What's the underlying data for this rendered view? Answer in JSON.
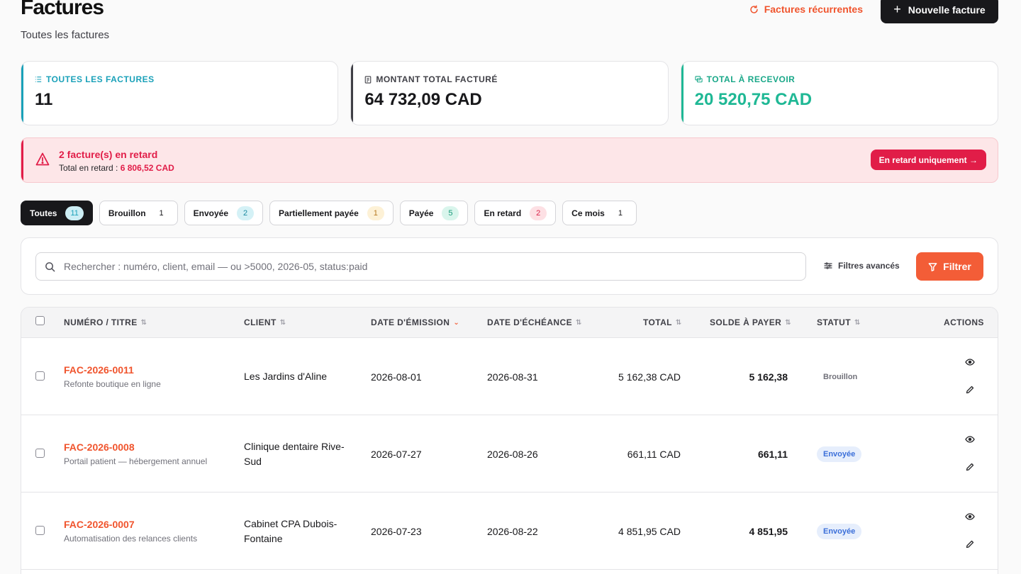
{
  "header": {
    "title": "Factures",
    "subtitle": "Toutes les factures",
    "recurring_label": "Factures récurrentes",
    "new_invoice_label": "Nouvelle facture"
  },
  "stats": [
    {
      "label": "TOUTES LES FACTURES",
      "value": "11",
      "icon": "list-icon"
    },
    {
      "label": "MONTANT TOTAL FACTURÉ",
      "value": "64 732,09 CAD",
      "icon": "receipt-icon"
    },
    {
      "label": "TOTAL À RECEVOIR",
      "value": "20 520,75 CAD",
      "icon": "coins-icon"
    }
  ],
  "alert": {
    "title": "2 facture(s) en retard",
    "sub_prefix": "Total en retard :",
    "sub_amount": "6 806,52 CAD",
    "button": "En retard uniquement →"
  },
  "filters": [
    {
      "label": "Toutes",
      "count": "11"
    },
    {
      "label": "Brouillon",
      "count": "1"
    },
    {
      "label": "Envoyée",
      "count": "2"
    },
    {
      "label": "Partiellement payée",
      "count": "1"
    },
    {
      "label": "Payée",
      "count": "5"
    },
    {
      "label": "En retard",
      "count": "2"
    },
    {
      "label": "Ce mois",
      "count": "1"
    }
  ],
  "search": {
    "placeholder": "Rechercher : numéro, client, email — ou >5000, 2026-05, status:paid",
    "advanced_label": "Filtres avancés",
    "filter_button": "Filtrer"
  },
  "table": {
    "columns": {
      "number": "NUMÉRO / TITRE",
      "client": "CLIENT",
      "issue": "DATE D'ÉMISSION",
      "due": "DATE D'ÉCHÉANCE",
      "total": "TOTAL",
      "balance": "SOLDE À PAYER",
      "status": "STATUT",
      "actions": "ACTIONS"
    },
    "rows": [
      {
        "number": "FAC-2026-0011",
        "title": "Refonte boutique en ligne",
        "client": "Les Jardins d'Aline",
        "issue": "2026-08-01",
        "due": "2026-08-31",
        "total": "5 162,38 CAD",
        "balance": "5 162,38",
        "status": "Brouillon"
      },
      {
        "number": "FAC-2026-0008",
        "title": "Portail patient — hébergement annuel",
        "client": "Clinique dentaire Rive-Sud",
        "issue": "2026-07-27",
        "due": "2026-08-26",
        "total": "661,11 CAD",
        "balance": "661,11",
        "status": "Envoyée"
      },
      {
        "number": "FAC-2026-0007",
        "title": "Automatisation des relances clients",
        "client": "Cabinet CPA Dubois-Fontaine",
        "issue": "2026-07-23",
        "due": "2026-08-22",
        "total": "4 851,95 CAD",
        "balance": "4 851,95",
        "status": "Envoyée"
      }
    ]
  },
  "colors": {
    "accent": "#f35d37",
    "cyan": "#1aa1b9",
    "teal": "#1fb895",
    "danger": "#e11d48"
  }
}
